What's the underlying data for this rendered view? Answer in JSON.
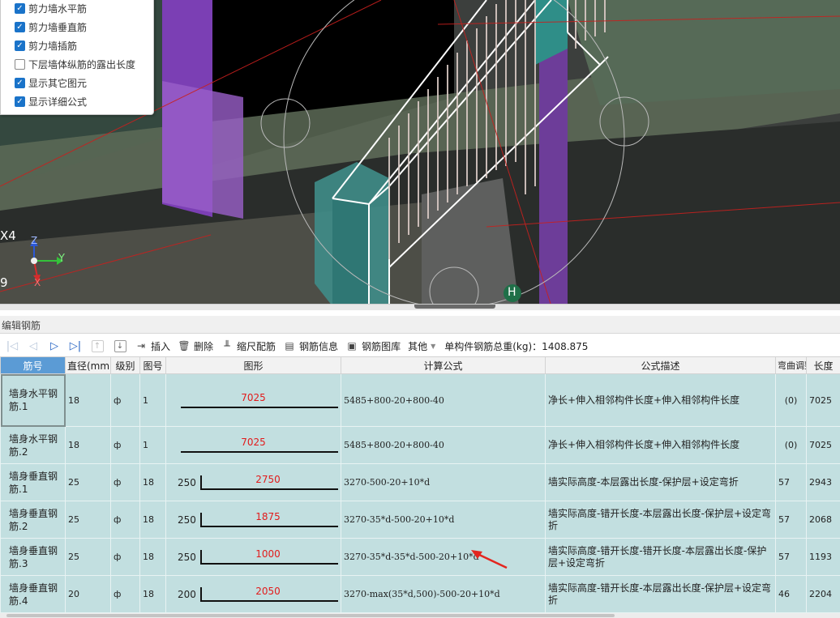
{
  "viewport": {
    "layers": [
      {
        "label": "剪力墙水平筋",
        "checked": true
      },
      {
        "label": "剪力墙垂直筋",
        "checked": true
      },
      {
        "label": "剪力墙插筋",
        "checked": true
      },
      {
        "label": "下层墙体纵筋的露出长度",
        "checked": false
      },
      {
        "label": "显示其它图元",
        "checked": true
      },
      {
        "label": "显示详细公式",
        "checked": true
      }
    ],
    "axis_labels": {
      "x": "X",
      "y": "Y",
      "z": "Z"
    },
    "grid_labels": {
      "left_a": "4",
      "left_b": "9",
      "marker": "H"
    }
  },
  "panel": {
    "title": "编辑钢筋"
  },
  "toolbar": {
    "insert": "插入",
    "delete": "删除",
    "scale": "缩尺配筋",
    "info": "钢筋信息",
    "library": "钢筋图库",
    "other": "其他",
    "total": "单构件钢筋总重(kg)：1408.875"
  },
  "table": {
    "headers": {
      "name": "筋号",
      "dia": "直径(mm)",
      "grade": "级别",
      "fig": "图号",
      "shape": "图形",
      "formula": "计算公式",
      "desc": "公式描述",
      "bend": "弯曲调整",
      "length": "长度"
    },
    "rows": [
      {
        "name": "墙身水平钢筋.1",
        "dia": "18",
        "grade": "ф",
        "fig": "1",
        "shape_left": "",
        "shape_value": "7025",
        "formula": "5485+800-20+800-40",
        "desc": "净长+伸入相邻构件长度+伸入相邻构件长度",
        "bend": "(0)",
        "length": "7025"
      },
      {
        "name": "墙身水平钢筋.2",
        "dia": "18",
        "grade": "ф",
        "fig": "1",
        "shape_left": "",
        "shape_value": "7025",
        "formula": "5485+800-20+800-40",
        "desc": "净长+伸入相邻构件长度+伸入相邻构件长度",
        "bend": "(0)",
        "length": "7025"
      },
      {
        "name": "墙身垂直钢筋.1",
        "dia": "25",
        "grade": "ф",
        "fig": "18",
        "shape_left": "250",
        "shape_value": "2750",
        "formula": "3270-500-20+10*d",
        "desc": "墙实际高度-本层露出长度-保护层+设定弯折",
        "bend": "57",
        "length": "2943"
      },
      {
        "name": "墙身垂直钢筋.2",
        "dia": "25",
        "grade": "ф",
        "fig": "18",
        "shape_left": "250",
        "shape_value": "1875",
        "formula": "3270-35*d-500-20+10*d",
        "desc": "墙实际高度-错开长度-本层露出长度-保护层+设定弯折",
        "bend": "57",
        "length": "2068"
      },
      {
        "name": "墙身垂直钢筋.3",
        "dia": "25",
        "grade": "ф",
        "fig": "18",
        "shape_left": "250",
        "shape_value": "1000",
        "formula": "3270-35*d-35*d-500-20+10*d",
        "desc": "墙实际高度-错开长度-错开长度-本层露出长度-保护层+设定弯折",
        "bend": "57",
        "length": "1193"
      },
      {
        "name": "墙身垂直钢筋.4",
        "dia": "20",
        "grade": "ф",
        "fig": "18",
        "shape_left": "200",
        "shape_value": "2050",
        "formula": "3270-max(35*d,500)-500-20+10*d",
        "desc": "墙实际高度-错开长度-本层露出长度-保护层+设定弯折",
        "bend": "46",
        "length": "2204"
      }
    ]
  }
}
